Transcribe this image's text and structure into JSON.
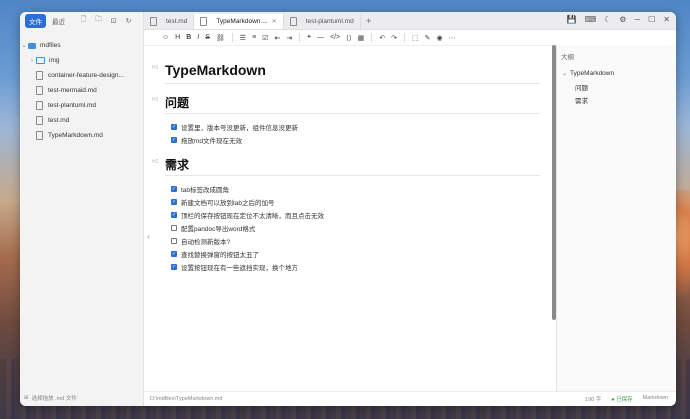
{
  "colors": {
    "accent": "#2b6fd6",
    "saved": "#3a9a4a"
  },
  "sidebar": {
    "file_button": "文件",
    "recent_button": "最近",
    "root_folder": "mdfiles",
    "items": [
      {
        "label": "img",
        "type": "folder"
      },
      {
        "label": "container-feature-design...",
        "type": "file"
      },
      {
        "label": "test-mermaid.md",
        "type": "file"
      },
      {
        "label": "test-plantuml.md",
        "type": "file"
      },
      {
        "label": "test.md",
        "type": "file"
      },
      {
        "label": "TypeMarkdown.md",
        "type": "file"
      }
    ],
    "bottom_text": "选择拖放 .md 文件"
  },
  "tabs": [
    {
      "label": "test.md",
      "active": false
    },
    {
      "label": "TypeMarkdown....",
      "active": true
    },
    {
      "label": "test-plantuml.md",
      "active": false
    }
  ],
  "toolbar_icons": [
    "emoji-icon",
    "heading-icon",
    "bold-icon",
    "italic-icon",
    "strikethrough-icon",
    "link-icon",
    "bullet-list-icon",
    "ordered-list-icon",
    "task-list-icon",
    "outdent-icon",
    "indent-icon",
    "quote-icon",
    "hr-icon",
    "code-icon",
    "code-block-icon",
    "table-icon",
    "undo-icon",
    "redo-icon",
    "insert-icon",
    "edit-icon",
    "preview-icon",
    "more-icon"
  ],
  "editor": {
    "h1_marker": "H1",
    "h2_marker": "H2",
    "title": "TypeMarkdown",
    "sections": [
      {
        "heading": "问题",
        "tasks": [
          {
            "text": "设置里，版本号没更新，组件信息没更新",
            "done": true
          },
          {
            "text": "拖放md文件现在无效",
            "done": true
          }
        ]
      },
      {
        "heading": "需求",
        "tasks": [
          {
            "text": "tab标签改成圆角",
            "done": true
          },
          {
            "text": "新建文档可以放到tab之后的加号",
            "done": true
          },
          {
            "text": "顶栏的保存按钮现在定位不太清晰，而且点击无效",
            "done": true
          },
          {
            "text": "配置pandoc导出word格式",
            "done": false
          },
          {
            "text": "自动检测新版本?",
            "done": false
          },
          {
            "text": "查找替换弹窗的按钮太丑了",
            "done": true
          },
          {
            "text": "设置按钮现在有一些遮挡实现，换个地方",
            "done": true
          }
        ]
      }
    ]
  },
  "outline": {
    "title": "大纲",
    "root": "TypeMarkdown",
    "items": [
      "问题",
      "需求"
    ]
  },
  "statusbar": {
    "path": "D:\\mdfiles\\TypeMarkdown.md",
    "chars": "190 字",
    "saved": "● 已保存",
    "mode": "Markdown"
  }
}
